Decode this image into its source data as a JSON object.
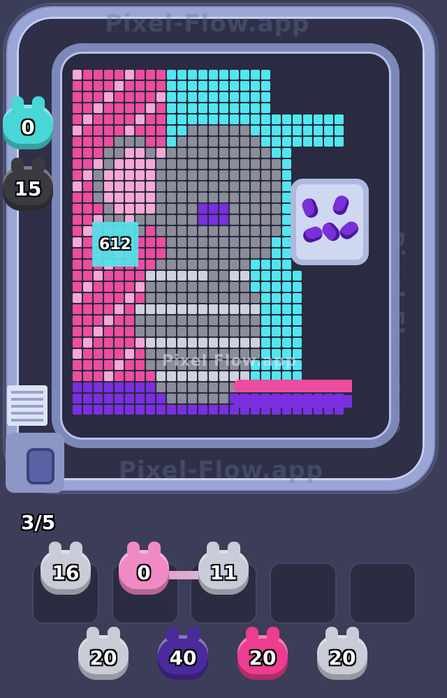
{
  "watermark": "Pixel Flow.app",
  "watermark_top": "Pixel-Flow.app",
  "watermark_side": "Pixel-Flow.app",
  "region_count": "612",
  "progress": "3/5",
  "conveyor_shooters": [
    {
      "count": "0",
      "color": "#49d6d6"
    },
    {
      "count": "15",
      "color": "#3a3a40"
    }
  ],
  "active_slots": [
    {
      "count": "16",
      "color": "#c9ccd6"
    },
    {
      "count": "0",
      "color": "#f08ac4"
    },
    {
      "count": "11",
      "color": "#c9ccd6"
    },
    {
      "count": "",
      "color": ""
    },
    {
      "count": "",
      "color": ""
    }
  ],
  "waiting_queue": [
    {
      "count": "20",
      "color": "#c9ccd6"
    },
    {
      "count": "40",
      "color": "#4b2a9c"
    },
    {
      "count": "20",
      "color": "#ec3d8e"
    },
    {
      "count": "20",
      "color": "#c9ccd6"
    }
  ],
  "colors": {
    "pink": "#ec4d9e",
    "light_pink": "#f5a8d2",
    "cyan": "#52e6ef",
    "gray": "#8b8d99",
    "light_gray": "#cfd1db",
    "purple": "#7a2fe0",
    "dark": "#2a2438",
    "white": "#f4f4fa"
  }
}
